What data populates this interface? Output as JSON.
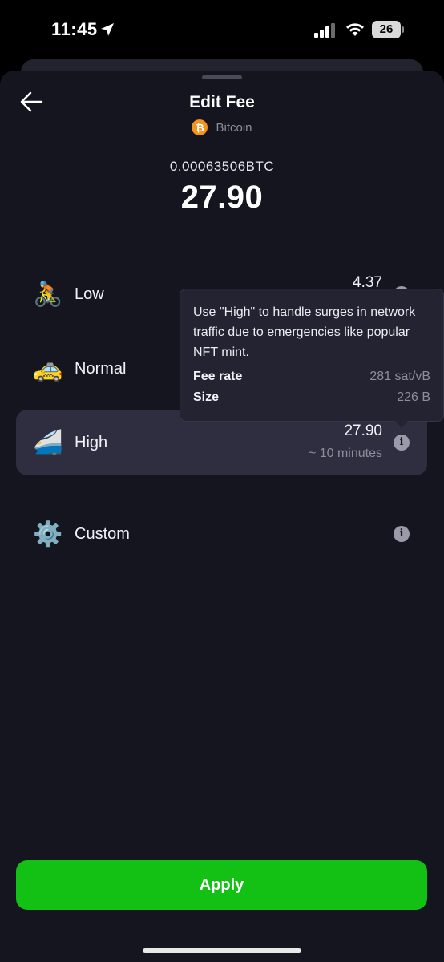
{
  "status_bar": {
    "time": "11:45",
    "battery": "26",
    "icons": [
      "location-arrow-icon",
      "signal-icon",
      "wifi-icon",
      "battery-icon"
    ]
  },
  "header": {
    "title": "Edit Fee",
    "network": "Bitcoin",
    "icons": [
      "back-arrow-icon",
      "bitcoin-icon"
    ]
  },
  "fee": {
    "crypto_amount": "0.00063506BTC",
    "fiat_amount": "27.90"
  },
  "options": [
    {
      "id": "low",
      "label": "Low",
      "value": "4.37",
      "time": "",
      "emoji": "🚴",
      "selected": false
    },
    {
      "id": "normal",
      "label": "Normal",
      "value": "",
      "time": "",
      "emoji": "🚕",
      "selected": false
    },
    {
      "id": "high",
      "label": "High",
      "value": "27.90",
      "time": "~ 10 minutes",
      "emoji": "🚄",
      "selected": true
    },
    {
      "id": "custom",
      "label": "Custom",
      "value": "",
      "time": "",
      "emoji": "⚙️",
      "selected": false
    }
  ],
  "tooltip": {
    "text": "Use \"High\" to handle surges in network traffic due to emergencies like popular NFT mint.",
    "rows": [
      {
        "label": "Fee rate",
        "value": "281 sat/vB"
      },
      {
        "label": "Size",
        "value": "226 B"
      }
    ]
  },
  "apply_label": "Apply",
  "colors": {
    "background": "#151520",
    "selected": "#2e2e40",
    "apply": "#13c114",
    "bitcoin": "#f7931a",
    "muted_text": "#8d8d9b"
  }
}
